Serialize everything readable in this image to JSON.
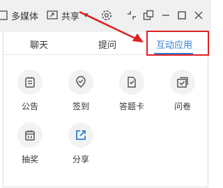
{
  "toolbar": {
    "media_label": "多媒体",
    "share_label": "共享"
  },
  "tabs": [
    {
      "label": "聊天"
    },
    {
      "label": "提问"
    },
    {
      "label": "互动应用"
    }
  ],
  "apps": [
    {
      "label": "公告",
      "icon": "notice-icon"
    },
    {
      "label": "签到",
      "icon": "checkin-icon"
    },
    {
      "label": "答题卡",
      "icon": "answer-card-icon"
    },
    {
      "label": "问卷",
      "icon": "survey-icon"
    },
    {
      "label": "抽奖",
      "icon": "lottery-icon"
    },
    {
      "label": "分享",
      "icon": "share-app-icon"
    }
  ],
  "colors": {
    "accent": "#2f7fd6",
    "annotation": "#e02020",
    "icon_gray": "#555555"
  }
}
